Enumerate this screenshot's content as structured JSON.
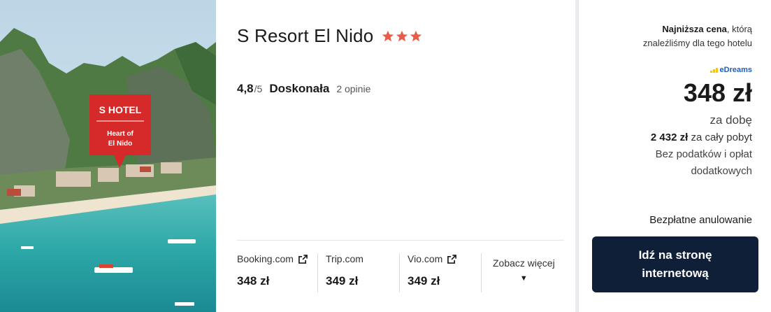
{
  "hotel": {
    "name": "S Resort El Nido",
    "stars": 3,
    "star_color": "#e85c4a",
    "image_caption": {
      "brand": "S HOTEL",
      "tagline_line1": "Heart of",
      "tagline_line2": "El Nido"
    }
  },
  "rating": {
    "score": "4,8",
    "max": "/5",
    "label": "Doskonała",
    "reviews": "2 opinie"
  },
  "providers": [
    {
      "name": "Booking.com",
      "price": "348 zł",
      "external_icon": "external-link-icon"
    },
    {
      "name": "Trip.com",
      "price": "349 zł"
    },
    {
      "name": "Vio.com",
      "price": "349 zł",
      "external_icon": "external-link-icon"
    }
  ],
  "see_more": {
    "label": "Zobacz więcej",
    "icon": "caret-down-icon"
  },
  "offer": {
    "lowest_bold": "Najniższa cena",
    "lowest_rest1": ", którą",
    "lowest_rest2": "znaleźliśmy dla tego hotelu",
    "provider_logo": "eDreams",
    "price": "348 zł",
    "per_night": "za dobę",
    "total_amount": "2 432 zł",
    "total_label": " za cały pobyt",
    "taxes_line1": "Bez podatków i opłat",
    "taxes_line2": "dodatkowych",
    "free_cancel": "Bezpłatne anulowanie",
    "cta_line1": "Idź na stronę",
    "cta_line2": "internetową",
    "cta_color": "#0f1f38"
  }
}
